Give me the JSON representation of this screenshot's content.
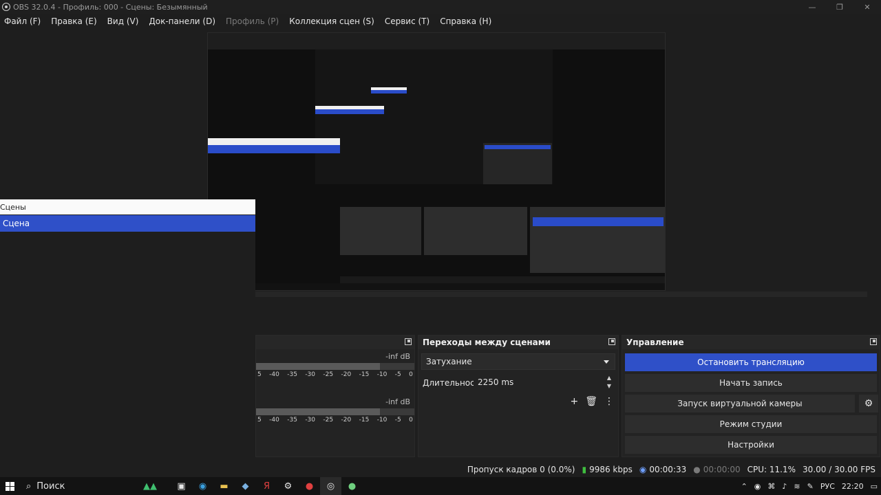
{
  "window": {
    "title": "OBS 32.0.4 - Профиль: 000 - Сцены: Безымянный",
    "minimize_glyph": "—",
    "maximize_glyph": "❐",
    "close_glyph": "✕"
  },
  "menu": {
    "items": [
      "Файл (F)",
      "Правка (E)",
      "Вид (V)",
      "Док-панели (D)",
      "Профиль (P)",
      "Коллекция сцен (S)",
      "Сервис (T)",
      "Справка (H)"
    ]
  },
  "scenes": {
    "header": "Сцены",
    "items": [
      "Сцена"
    ]
  },
  "mixer": {
    "track1_level": "-inf dB",
    "track2_level": "-inf dB",
    "scale": [
      "5",
      "-40",
      "-35",
      "-30",
      "-25",
      "-20",
      "-15",
      "-10",
      "-5",
      "0"
    ]
  },
  "transitions": {
    "title": "Переходы между сценами",
    "selected": "Затухание",
    "duration_label": "Длительность",
    "duration_value": "2250 ms",
    "add_glyph": "+",
    "delete_glyph": "🗑",
    "more_glyph": "⋮",
    "spin_up": "▲",
    "spin_down": "▼"
  },
  "controls": {
    "title": "Управление",
    "stop_stream": "Остановить трансляцию",
    "start_record": "Начать запись",
    "virtual_cam": "Запуск виртуальной камеры",
    "studio_mode": "Режим студии",
    "settings": "Настройки",
    "gear_glyph": "⚙"
  },
  "status": {
    "dropped_frames": "Пропуск кадров 0 (0.0%)",
    "bitrate": "9986 kbps",
    "stream_time": "00:00:33",
    "record_time": "00:00:00",
    "cpu": "CPU: 11.1%",
    "fps": "30.00 / 30.00 FPS"
  },
  "taskbar": {
    "search_label": "Поиск",
    "language": "РУС",
    "time": "22:20"
  }
}
